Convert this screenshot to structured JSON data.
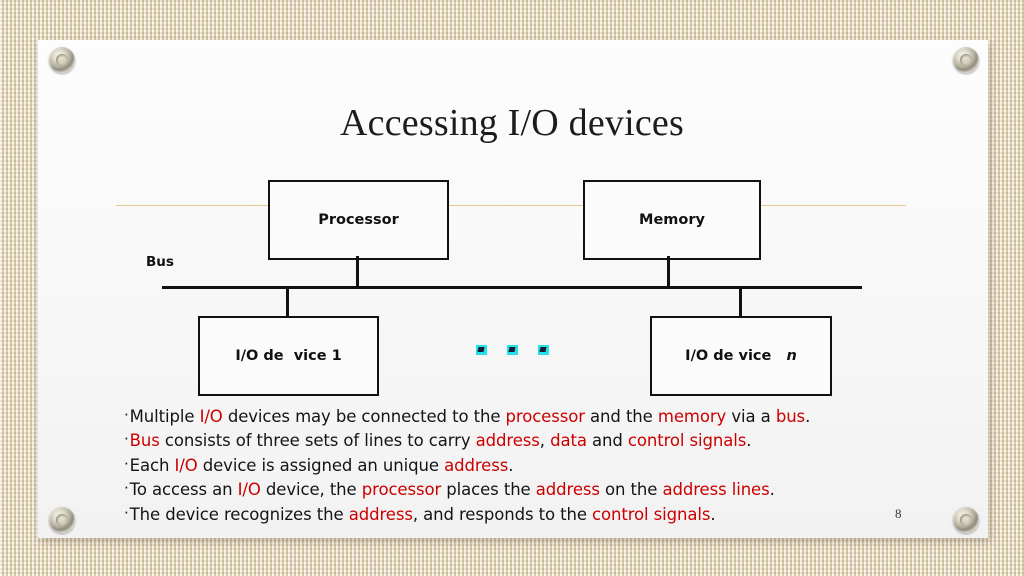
{
  "slide": {
    "title": "Accessing I/O devices",
    "number": "8",
    "accent_color": "#cc0000",
    "rule_color": "#e3c893",
    "background": "burlap-canvas-beige"
  },
  "diagram": {
    "bus_label": "Bus",
    "nodes": {
      "processor": "Processor",
      "memory": "Memory",
      "io_device_1": "I/O de  vice 1",
      "io_device_n_text": "I/O de vice   ",
      "io_device_n_italic": "n"
    },
    "ellipsis": [
      "dot",
      "dot",
      "dot"
    ]
  },
  "bullets": [
    {
      "marker": "·",
      "segments": [
        {
          "t": "Multiple ",
          "hl": false
        },
        {
          "t": "I/O",
          "hl": true
        },
        {
          "t": " devices may be connected to the ",
          "hl": false
        },
        {
          "t": "processor",
          "hl": true
        },
        {
          "t": " and the ",
          "hl": false
        },
        {
          "t": "memory",
          "hl": true
        },
        {
          "t": " via a ",
          "hl": false
        },
        {
          "t": "bus",
          "hl": true
        },
        {
          "t": ".",
          "hl": false
        }
      ]
    },
    {
      "marker": "·",
      "segments": [
        {
          "t": "Bus",
          "hl": true
        },
        {
          "t": " consists of three sets of lines to carry ",
          "hl": false
        },
        {
          "t": "address",
          "hl": true
        },
        {
          "t": ", ",
          "hl": false
        },
        {
          "t": "data",
          "hl": true
        },
        {
          "t": " and ",
          "hl": false
        },
        {
          "t": "control signals",
          "hl": true
        },
        {
          "t": ".",
          "hl": false
        }
      ]
    },
    {
      "marker": "·",
      "segments": [
        {
          "t": "Each ",
          "hl": false
        },
        {
          "t": "I/O",
          "hl": true
        },
        {
          "t": " device is assigned an unique ",
          "hl": false
        },
        {
          "t": "address",
          "hl": true
        },
        {
          "t": ".",
          "hl": false
        }
      ]
    },
    {
      "marker": "·",
      "segments": [
        {
          "t": "To access an ",
          "hl": false
        },
        {
          "t": "I/O",
          "hl": true
        },
        {
          "t": " device, the ",
          "hl": false
        },
        {
          "t": "processor",
          "hl": true
        },
        {
          "t": " places the ",
          "hl": false
        },
        {
          "t": "address",
          "hl": true
        },
        {
          "t": " on the ",
          "hl": false
        },
        {
          "t": "address lines",
          "hl": true
        },
        {
          "t": ".",
          "hl": false
        }
      ]
    },
    {
      "marker": "·",
      "segments": [
        {
          "t": "The device recognizes the ",
          "hl": false
        },
        {
          "t": "address",
          "hl": true
        },
        {
          "t": ", and responds to the ",
          "hl": false
        },
        {
          "t": "control signals",
          "hl": true
        },
        {
          "t": ".",
          "hl": false
        }
      ]
    }
  ]
}
